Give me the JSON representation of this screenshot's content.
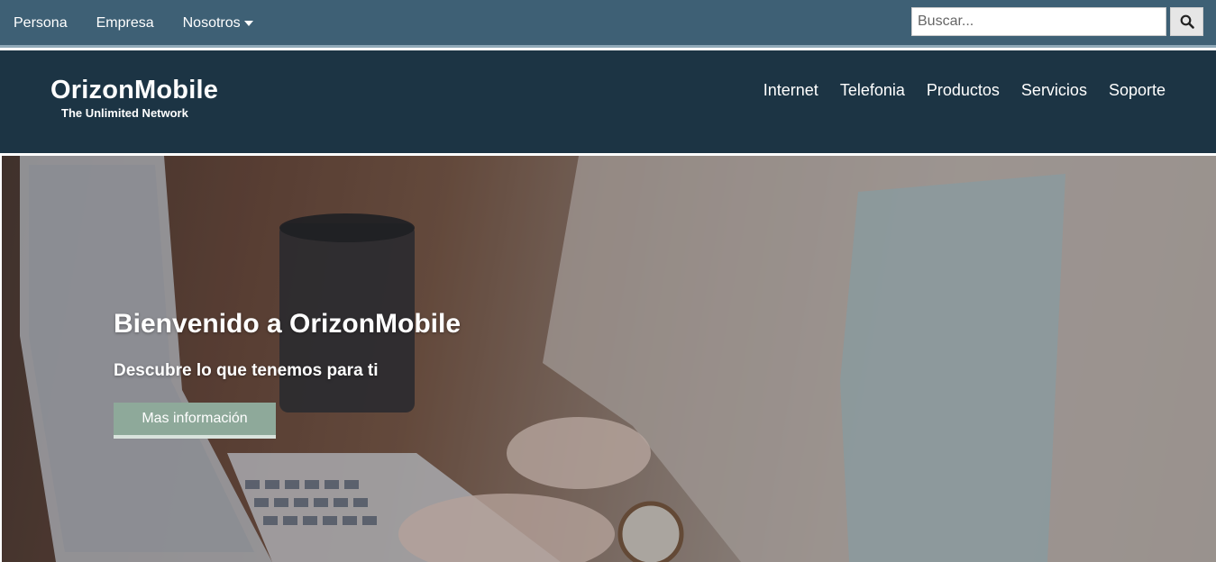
{
  "topbar": {
    "links": [
      "Persona",
      "Empresa",
      "Nosotros"
    ],
    "search_placeholder": "Buscar..."
  },
  "brand": {
    "name": "OrizonMobile",
    "tagline": "The Unlimited Network"
  },
  "nav": {
    "items": [
      "Internet",
      "Telefonia",
      "Productos",
      "Servicios",
      "Soporte"
    ]
  },
  "hero": {
    "title": "Bienvenido a OrizonMobile",
    "subtitle": "Descubre lo que tenemos para ti",
    "button": "Mas información"
  },
  "colors": {
    "topbar": "#3e6075",
    "header": "#1c3444",
    "button": "#8ea99a"
  }
}
